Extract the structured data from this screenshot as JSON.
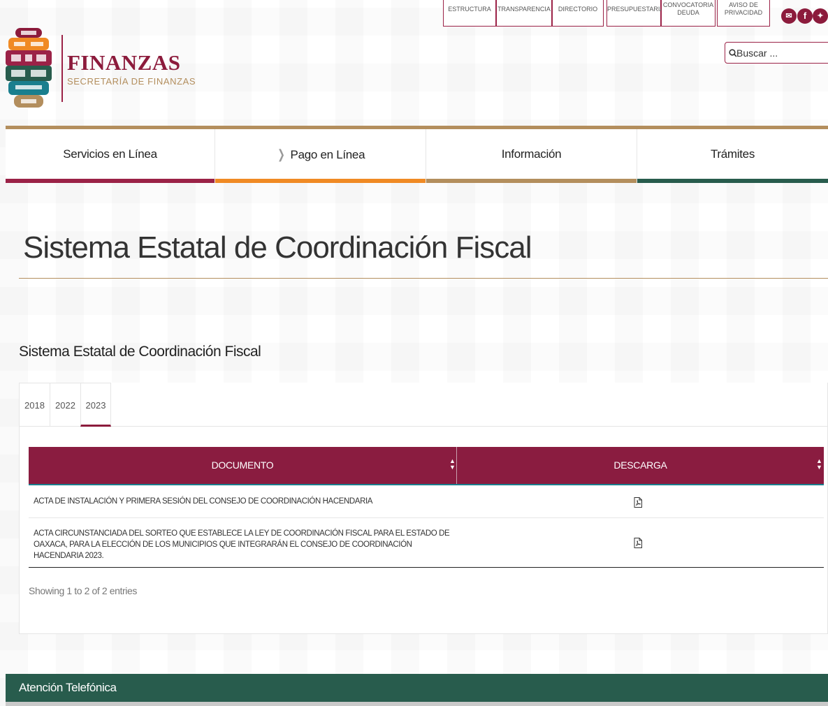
{
  "header": {
    "brand_title": "FINANZAS",
    "brand_subtitle": "SECRETARÍA DE FINANZAS",
    "top_links": [
      {
        "line1": "ESTRUCTURA",
        "line2": ""
      },
      {
        "line1": "TRANSPARENCIA",
        "line2": ""
      },
      {
        "line1": "DIRECTORIO",
        "line2": ""
      },
      {
        "line1": "PRESUPUESTARIA",
        "line2": ""
      },
      {
        "line1": "CONVOCATORIA",
        "line2": "DEUDA"
      },
      {
        "line1": "AVISO DE",
        "line2": "PRIVACIDAD"
      }
    ],
    "search_placeholder": "Buscar ...",
    "brand_color": "#8c1b3c",
    "gold_color": "#b38e5d"
  },
  "nav": {
    "items": [
      {
        "label": "Servicios en Línea",
        "accent": "#9b2247"
      },
      {
        "label": "Pago en Línea",
        "accent": "#f08a24"
      },
      {
        "label": "Información",
        "accent": "#b38e5d"
      },
      {
        "label": "Trámites",
        "accent": "#285c4d"
      }
    ]
  },
  "main": {
    "page_title": "Sistema Estatal de Coordinación Fiscal",
    "section_title": "Sistema Estatal de Coordinación Fiscal",
    "tabs": [
      {
        "label": "2018",
        "active": false
      },
      {
        "label": "2022",
        "active": false
      },
      {
        "label": "2023",
        "active": true
      }
    ],
    "table": {
      "columns": [
        "DOCUMENTO",
        "DESCARGA"
      ],
      "rows": [
        {
          "documento": "ACTA DE INSTALACIÓN Y PRIMERA SESIÓN DEL CONSEJO DE COORDINACIÓN HACENDARIA",
          "descarga_icon": "pdf-file-icon"
        },
        {
          "documento": "ACTA CIRCUNSTANCIADA DEL SORTEO QUE ESTABLECE LA LEY DE COORDINACIÓN FISCAL PARA EL ESTADO DE OAXACA, PARA LA ELECCIÓN DE LOS MUNICIPIOS QUE INTEGRARÁN EL CONSEJO DE COORDINACIÓN HACENDARIA 2023.",
          "descarga_icon": "pdf-file-icon"
        }
      ],
      "info": "Showing 1 to 2 of 2 entries"
    }
  },
  "footer": {
    "label": "Atención Telefónica"
  }
}
